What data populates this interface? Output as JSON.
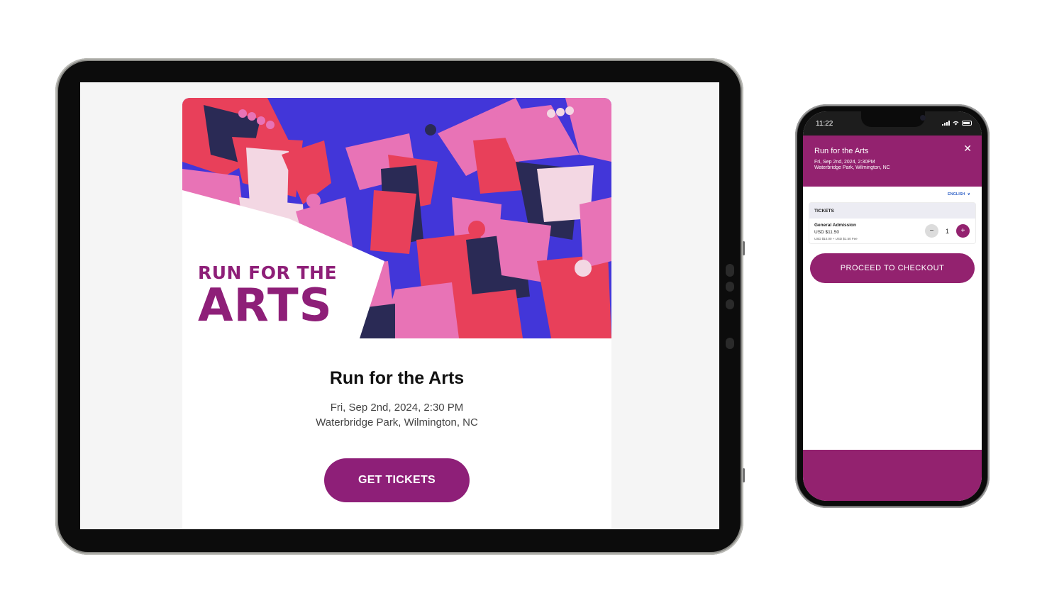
{
  "tablet": {
    "hero_art": {
      "title_line1": "RUN FOR THE",
      "title_line2": "ARTS",
      "palette": [
        "#4236d9",
        "#e8405a",
        "#e873b6",
        "#2a2a55",
        "#f3d7e3",
        "#ffffff"
      ]
    },
    "event": {
      "title": "Run for the Arts",
      "date": "Fri, Sep 2nd, 2024, 2:30 PM",
      "location": "Waterbridge Park, Wilmington, NC"
    },
    "cta_label": "GET TICKETS"
  },
  "phone": {
    "status_time": "11:22",
    "header": {
      "title": "Run for the Arts",
      "date": "Fri, Sep 2nd, 2024, 2:30PM",
      "location": "Waterbridge Park, Wilmington, NC",
      "close_icon": "close-icon"
    },
    "language": "ENGLISH",
    "tickets": {
      "section_label": "TICKETS",
      "items": [
        {
          "name": "General Admission",
          "price": "USD $11.50",
          "fee_note": "USD $10.00 + USD $1.50 Fee",
          "quantity": "1"
        }
      ]
    },
    "checkout_label": "PROCEED TO CHECKOUT"
  },
  "colors": {
    "brand": "#93226f",
    "link": "#3566c8"
  }
}
